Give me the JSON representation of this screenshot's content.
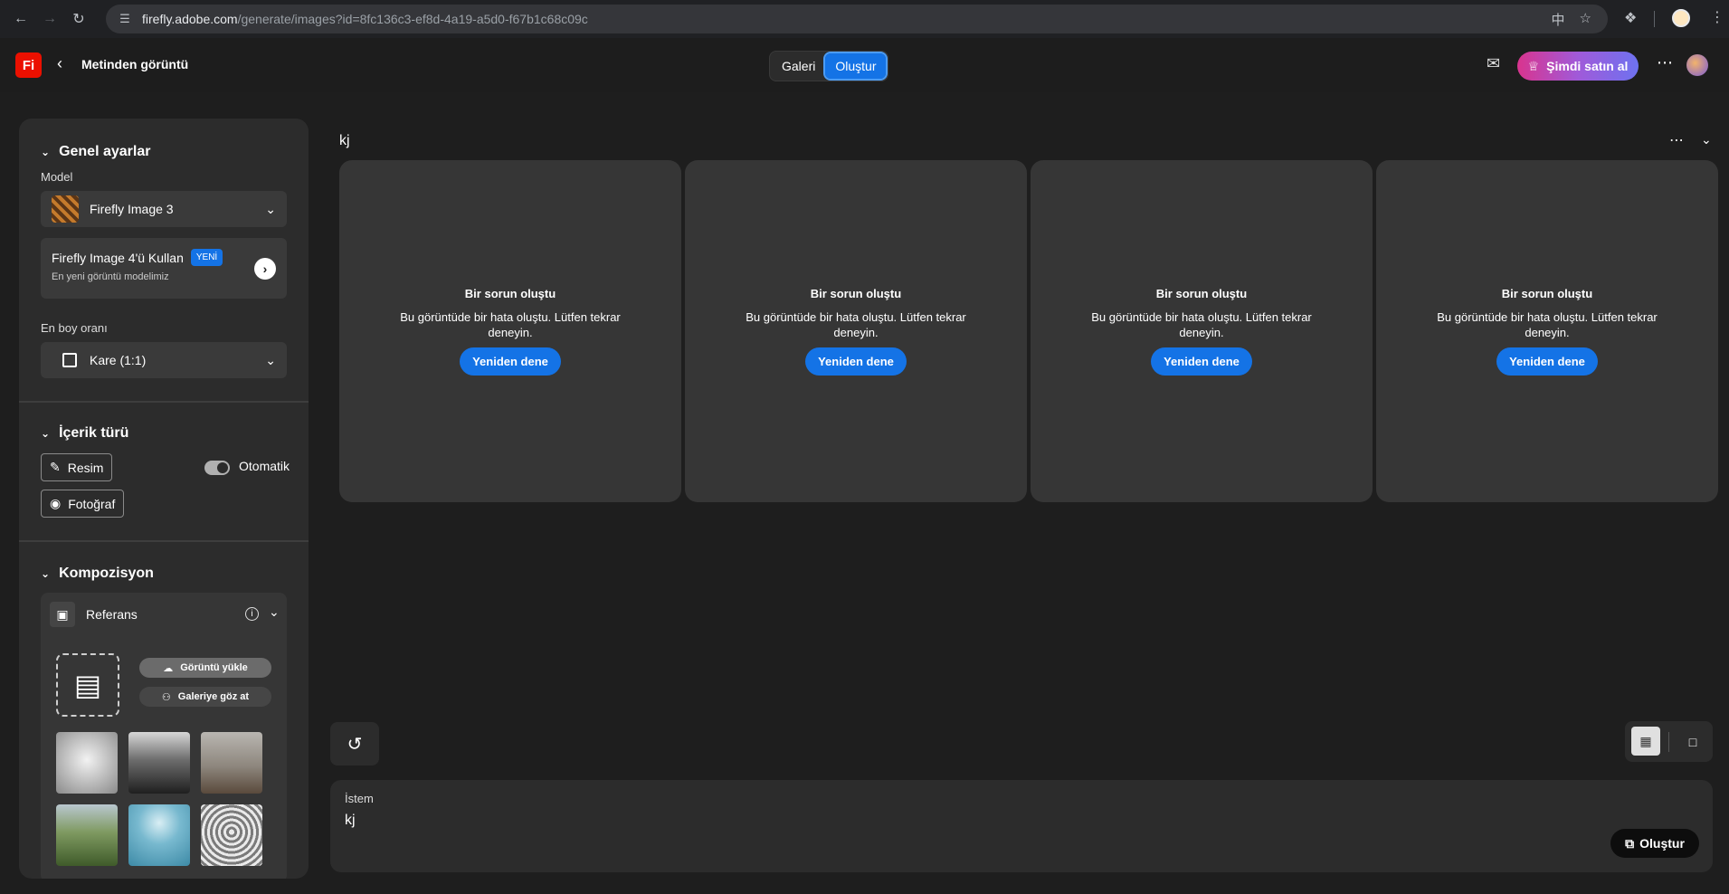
{
  "browser": {
    "url_host": "firefly.adobe.com",
    "url_path": "/generate/images?id=8fc136c3-ef8d-4a19-a5d0-f67b1c68c09c"
  },
  "header": {
    "logo": "Fi",
    "breadcrumb": "Metinden görüntü",
    "tabs": [
      "Galeri",
      "Oluştur"
    ],
    "buy_label": "Şimdi satın al"
  },
  "sidebar": {
    "general_title": "Genel ayarlar",
    "model_label": "Model",
    "model_value": "Firefly Image 3",
    "promo_title": "Firefly Image 4'ü Kullan",
    "promo_badge": "YENİ",
    "promo_sub": "En yeni görüntü modelimiz",
    "aspect_label": "En boy oranı",
    "aspect_value": "Kare (1:1)",
    "content_title": "İçerik türü",
    "content_art": "Resim",
    "content_photo": "Fotoğraf",
    "auto_label": "Otomatik",
    "composition_title": "Kompozisyon",
    "reference_label": "Referans",
    "upload_label": "Görüntü yükle",
    "browse_label": "Galeriye göz at"
  },
  "main": {
    "prompt_title": "kj",
    "error_title": "Bir sorun oluştu",
    "error_text": "Bu görüntüde bir hata oluştu. Lütfen tekrar deneyin.",
    "retry_label": "Yeniden dene",
    "prompt_label": "İstem",
    "prompt_value": "kj",
    "generate_label": "Oluştur"
  },
  "colors": {
    "accent": "#1473e6",
    "brand": "#eb1000"
  }
}
